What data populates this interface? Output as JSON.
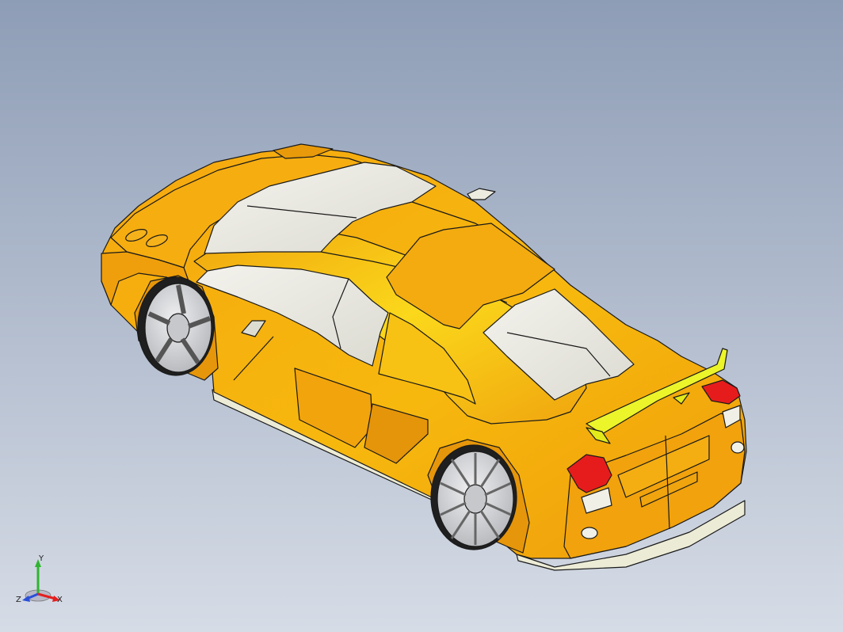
{
  "viewport": {
    "background_top": "#8e9db6",
    "background_bottom": "#d6dce6"
  },
  "model": {
    "body_color": "#f2a20c",
    "body_highlight": "#ffd21a",
    "glass_color": "#ecebe4",
    "light_color": "#e61c1c",
    "spoiler_color": "#e9f21c",
    "wheel_color": "#d9dadd",
    "edge_color": "#1a1a1a"
  },
  "triad": {
    "x_label": "X",
    "y_label": "Y",
    "z_label": "Z",
    "x_color": "#e41f1f",
    "y_color": "#2fb52f",
    "z_color": "#2a4fd8"
  }
}
